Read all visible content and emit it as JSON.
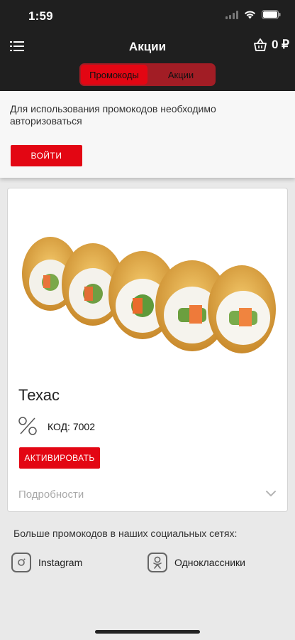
{
  "status_bar": {
    "time": "1:59"
  },
  "header": {
    "title": "Акции",
    "cart_amount": "0 ₽",
    "tabs": [
      {
        "label": "Промокоды",
        "active": true
      },
      {
        "label": "Акции",
        "active": false
      }
    ]
  },
  "login_notice": {
    "text": "Для использования промокодов необходимо авторизоваться",
    "button_label": "ВОЙТИ"
  },
  "promo": {
    "title": "Техас",
    "code": "КОД: 7002",
    "activate_label": "АКТИВИРОВАТЬ",
    "details_label": "Подробности"
  },
  "social": {
    "title": "Больше промокодов в наших социальных сетях:",
    "links": [
      {
        "label": "Instagram",
        "icon": "instagram-icon"
      },
      {
        "label": "Одноклассники",
        "icon": "odnoklassniki-icon"
      }
    ]
  },
  "colors": {
    "accent": "#e30613",
    "bar": "#1f1f1f",
    "segment_bg": "#a21d25"
  }
}
